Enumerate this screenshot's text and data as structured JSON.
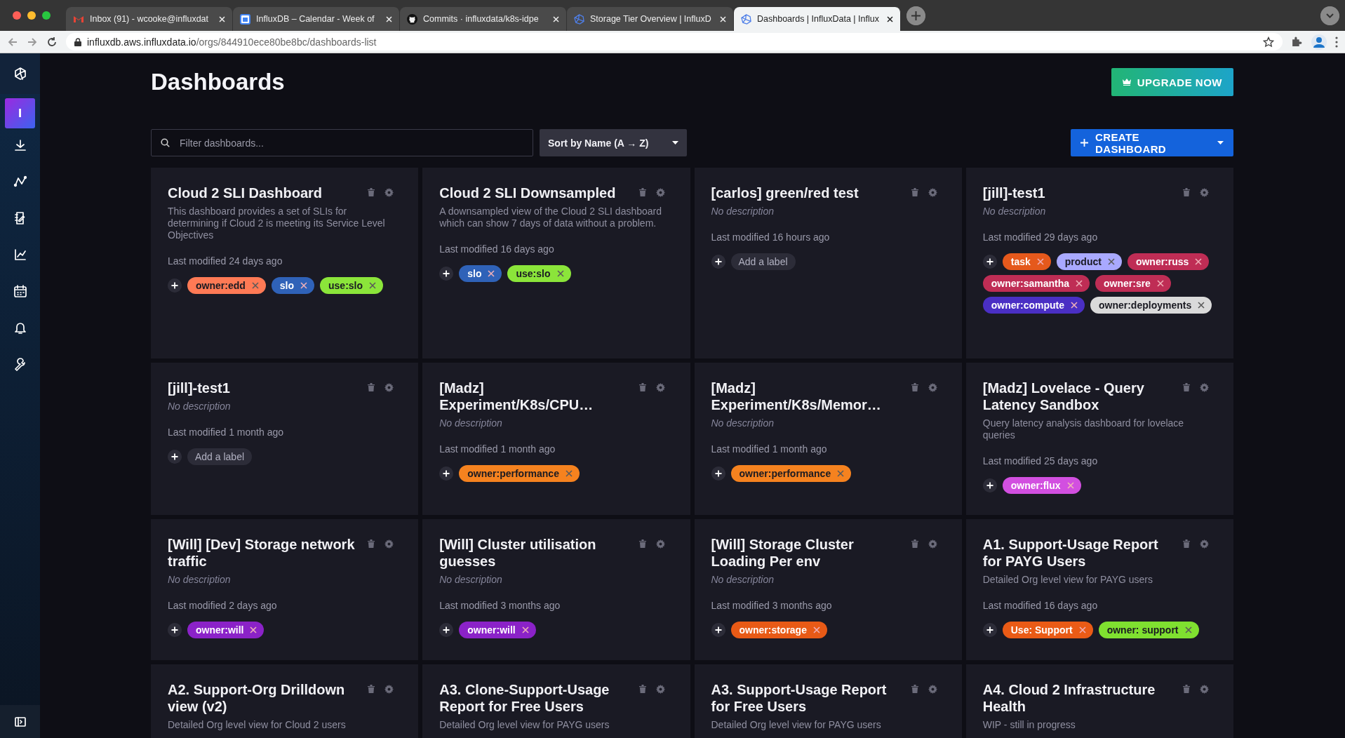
{
  "browser": {
    "tabs": [
      {
        "title": "Inbox (91) - wcooke@influxdat",
        "selected": false
      },
      {
        "title": "InfluxDB – Calendar - Week of",
        "selected": false
      },
      {
        "title": "Commits · influxdata/k8s-idpe",
        "selected": false
      },
      {
        "title": "Storage Tier Overview | InfluxD",
        "selected": false
      },
      {
        "title": "Dashboards | InfluxData | Influx",
        "selected": true
      }
    ],
    "url_host": "influxdb.aws.influxdata.io",
    "url_path": "/orgs/844910ece80be8bc/dashboards-list"
  },
  "sidebar": {
    "org_initial": "I"
  },
  "page": {
    "title": "Dashboards",
    "upgrade_button": "UPGRADE NOW",
    "filter_placeholder": "Filter dashboards...",
    "sort": "Sort by Name (A → Z)",
    "create_button": "CREATE DASHBOARD"
  },
  "cards": [
    {
      "title": "Cloud 2 SLI Dashboard",
      "description": "This dashboard provides a set of SLIs for determining if Cloud 2 is meeting its Service Level Objectives",
      "description_empty": false,
      "modified": "Last modified 24 days ago",
      "labels": [
        {
          "name": "owner:edd",
          "color": "#ff7a55"
        },
        {
          "name": "slo",
          "color": "#2f62b8"
        },
        {
          "name": "use:slo",
          "color": "#8be53a"
        }
      ]
    },
    {
      "title": "Cloud 2 SLI Downsampled",
      "description": "A downsampled view of the Cloud 2 SLI dashboard which can show 7 days of data without a problem.",
      "description_empty": false,
      "modified": "Last modified 16 days ago",
      "labels": [
        {
          "name": "slo",
          "color": "#2f62b8"
        },
        {
          "name": "use:slo",
          "color": "#8be53a"
        }
      ]
    },
    {
      "title": "[carlos] green/red test",
      "description": "No description",
      "description_empty": true,
      "modified": "Last modified 16 hours ago",
      "add_label": "Add a label"
    },
    {
      "title": "[jill]-test1",
      "description": "No description",
      "description_empty": true,
      "modified": "Last modified 29 days ago",
      "labels": [
        {
          "name": "task",
          "color": "#e5591c"
        },
        {
          "name": "product",
          "color": "#a9a9ff"
        },
        {
          "name": "owner:russ",
          "color": "#bf2d55"
        },
        {
          "name": "owner:samantha",
          "color": "#bf2d55"
        },
        {
          "name": "owner:sre",
          "color": "#bf2d55"
        },
        {
          "name": "owner:compute",
          "color": "#4a2fc4"
        },
        {
          "name": "owner:deployments",
          "color": "#dadada"
        }
      ]
    },
    {
      "title": "[jill]-test1",
      "description": "No description",
      "description_empty": true,
      "modified": "Last modified 1 month ago",
      "add_label": "Add a label"
    },
    {
      "title": "[Madz] Experiment/K8s/CPU…",
      "description": "No description",
      "description_empty": true,
      "modified": "Last modified 1 month ago",
      "labels": [
        {
          "name": "owner:performance",
          "color": "#f5821f"
        }
      ]
    },
    {
      "title": "[Madz] Experiment/K8s/Memor…",
      "description": "No description",
      "description_empty": true,
      "modified": "Last modified 1 month ago",
      "labels": [
        {
          "name": "owner:performance",
          "color": "#f5821f"
        }
      ]
    },
    {
      "title": "[Madz] Lovelace - Query Latency Sandbox",
      "description": "Query latency analysis dashboard for lovelace queries",
      "description_empty": false,
      "modified": "Last modified 25 days ago",
      "labels": [
        {
          "name": "owner:flux",
          "color": "#d24fe0"
        }
      ]
    },
    {
      "title": "[Will] [Dev] Storage network traffic",
      "description": "No description",
      "description_empty": true,
      "modified": "Last modified 2 days ago",
      "labels": [
        {
          "name": "owner:will",
          "color": "#8b22c8"
        }
      ]
    },
    {
      "title": "[Will] Cluster utilisation guesses",
      "description": "No description",
      "description_empty": true,
      "modified": "Last modified 3 months ago",
      "labels": [
        {
          "name": "owner:will",
          "color": "#8b22c8"
        }
      ]
    },
    {
      "title": "[Will] Storage Cluster Loading Per env",
      "description": "No description",
      "description_empty": true,
      "modified": "Last modified 3 months ago",
      "labels": [
        {
          "name": "owner:storage",
          "color": "#e85a16"
        }
      ]
    },
    {
      "title": "A1. Support-Usage Report for PAYG Users",
      "description": "Detailed Org level view for PAYG users",
      "description_empty": false,
      "modified": "Last modified 16 days ago",
      "labels": [
        {
          "name": "Use: Support",
          "color": "#ea5b16"
        },
        {
          "name": "owner: support",
          "color": "#7fe030"
        }
      ]
    },
    {
      "title": "A2. Support-Org Drilldown view (v2)",
      "description": "Detailed Org level view for Cloud 2 users",
      "description_empty": false
    },
    {
      "title": "A3. Clone-Support-Usage Report for Free Users",
      "description": "Detailed Org level view for PAYG users",
      "description_empty": false
    },
    {
      "title": "A3. Support-Usage Report for Free Users",
      "description": "Detailed Org level view for PAYG users",
      "description_empty": false
    },
    {
      "title": "A4. Cloud 2 Infrastructure Health",
      "description": "WIP - still in progress",
      "description_empty": false
    }
  ]
}
